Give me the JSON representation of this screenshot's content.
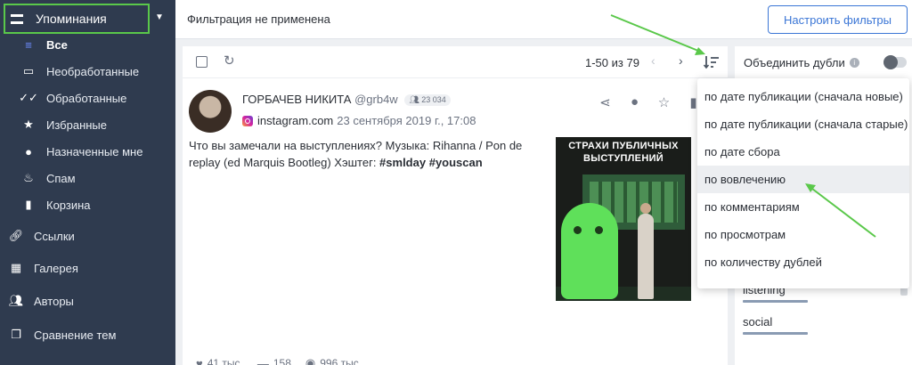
{
  "sidebar": {
    "header": {
      "label": "Упоминания",
      "icon": "mentions-icon"
    },
    "sub_items": [
      {
        "label": "Все",
        "icon": "all-icon",
        "active": true
      },
      {
        "label": "Необработанные",
        "icon": "inbox-icon"
      },
      {
        "label": "Обработанные",
        "icon": "double-check-icon"
      },
      {
        "label": "Избранные",
        "icon": "star-icon"
      },
      {
        "label": "Назначенные мне",
        "icon": "user-icon"
      },
      {
        "label": "Спам",
        "icon": "fire-icon"
      },
      {
        "label": "Корзина",
        "icon": "trash-icon"
      }
    ],
    "main_items": [
      {
        "label": "Ссылки",
        "icon": "link-icon"
      },
      {
        "label": "Галерея",
        "icon": "gallery-icon"
      },
      {
        "label": "Авторы",
        "icon": "users-icon"
      },
      {
        "label": "Сравнение тем",
        "icon": "compare-icon"
      }
    ]
  },
  "topbar": {
    "filter_status": "Фильтрация не применена",
    "configure_filters": "Настроить фильтры"
  },
  "toolbar": {
    "pager": "1-50 из 79",
    "prev": "‹",
    "next": "›"
  },
  "post": {
    "author": "ГОРБАЧЕВ НИКИТА",
    "handle": "@grb4w",
    "followers": "23 034",
    "source": "instagram.com",
    "date": "23 сентября 2019 г., 17:08",
    "text_plain": "Что вы замечали на выступлениях?   Музыка: Rihanna / Pon de replay (ed Marquis Bootleg)   Хэштег: ",
    "hashtag1": "#smlday",
    "hashtag2": "#youscan",
    "media_caption_line1": "СТРАХИ ПУБЛИЧНЫХ",
    "media_caption_line2": "ВЫСТУПЛЕНИЙ",
    "stats": {
      "likes": "41 тыс.",
      "comments": "158",
      "views": "996 тыс."
    }
  },
  "right_panel": {
    "merge_label": "Объединить дубли",
    "merge_enabled": false,
    "tags": [
      "listening",
      "social"
    ]
  },
  "sort_menu": {
    "items": [
      "по дате публикации (сначала новые)",
      "по дате публикации (сначала старые)",
      "по дате сбора",
      "по вовлечению",
      "по комментариям",
      "по просмотрам",
      "по количеству дублей"
    ],
    "highlighted_index": 3
  },
  "colors": {
    "sidebar_bg": "#2f3b4f",
    "accent": "#3b76d6",
    "annotation": "#5ac84a"
  }
}
